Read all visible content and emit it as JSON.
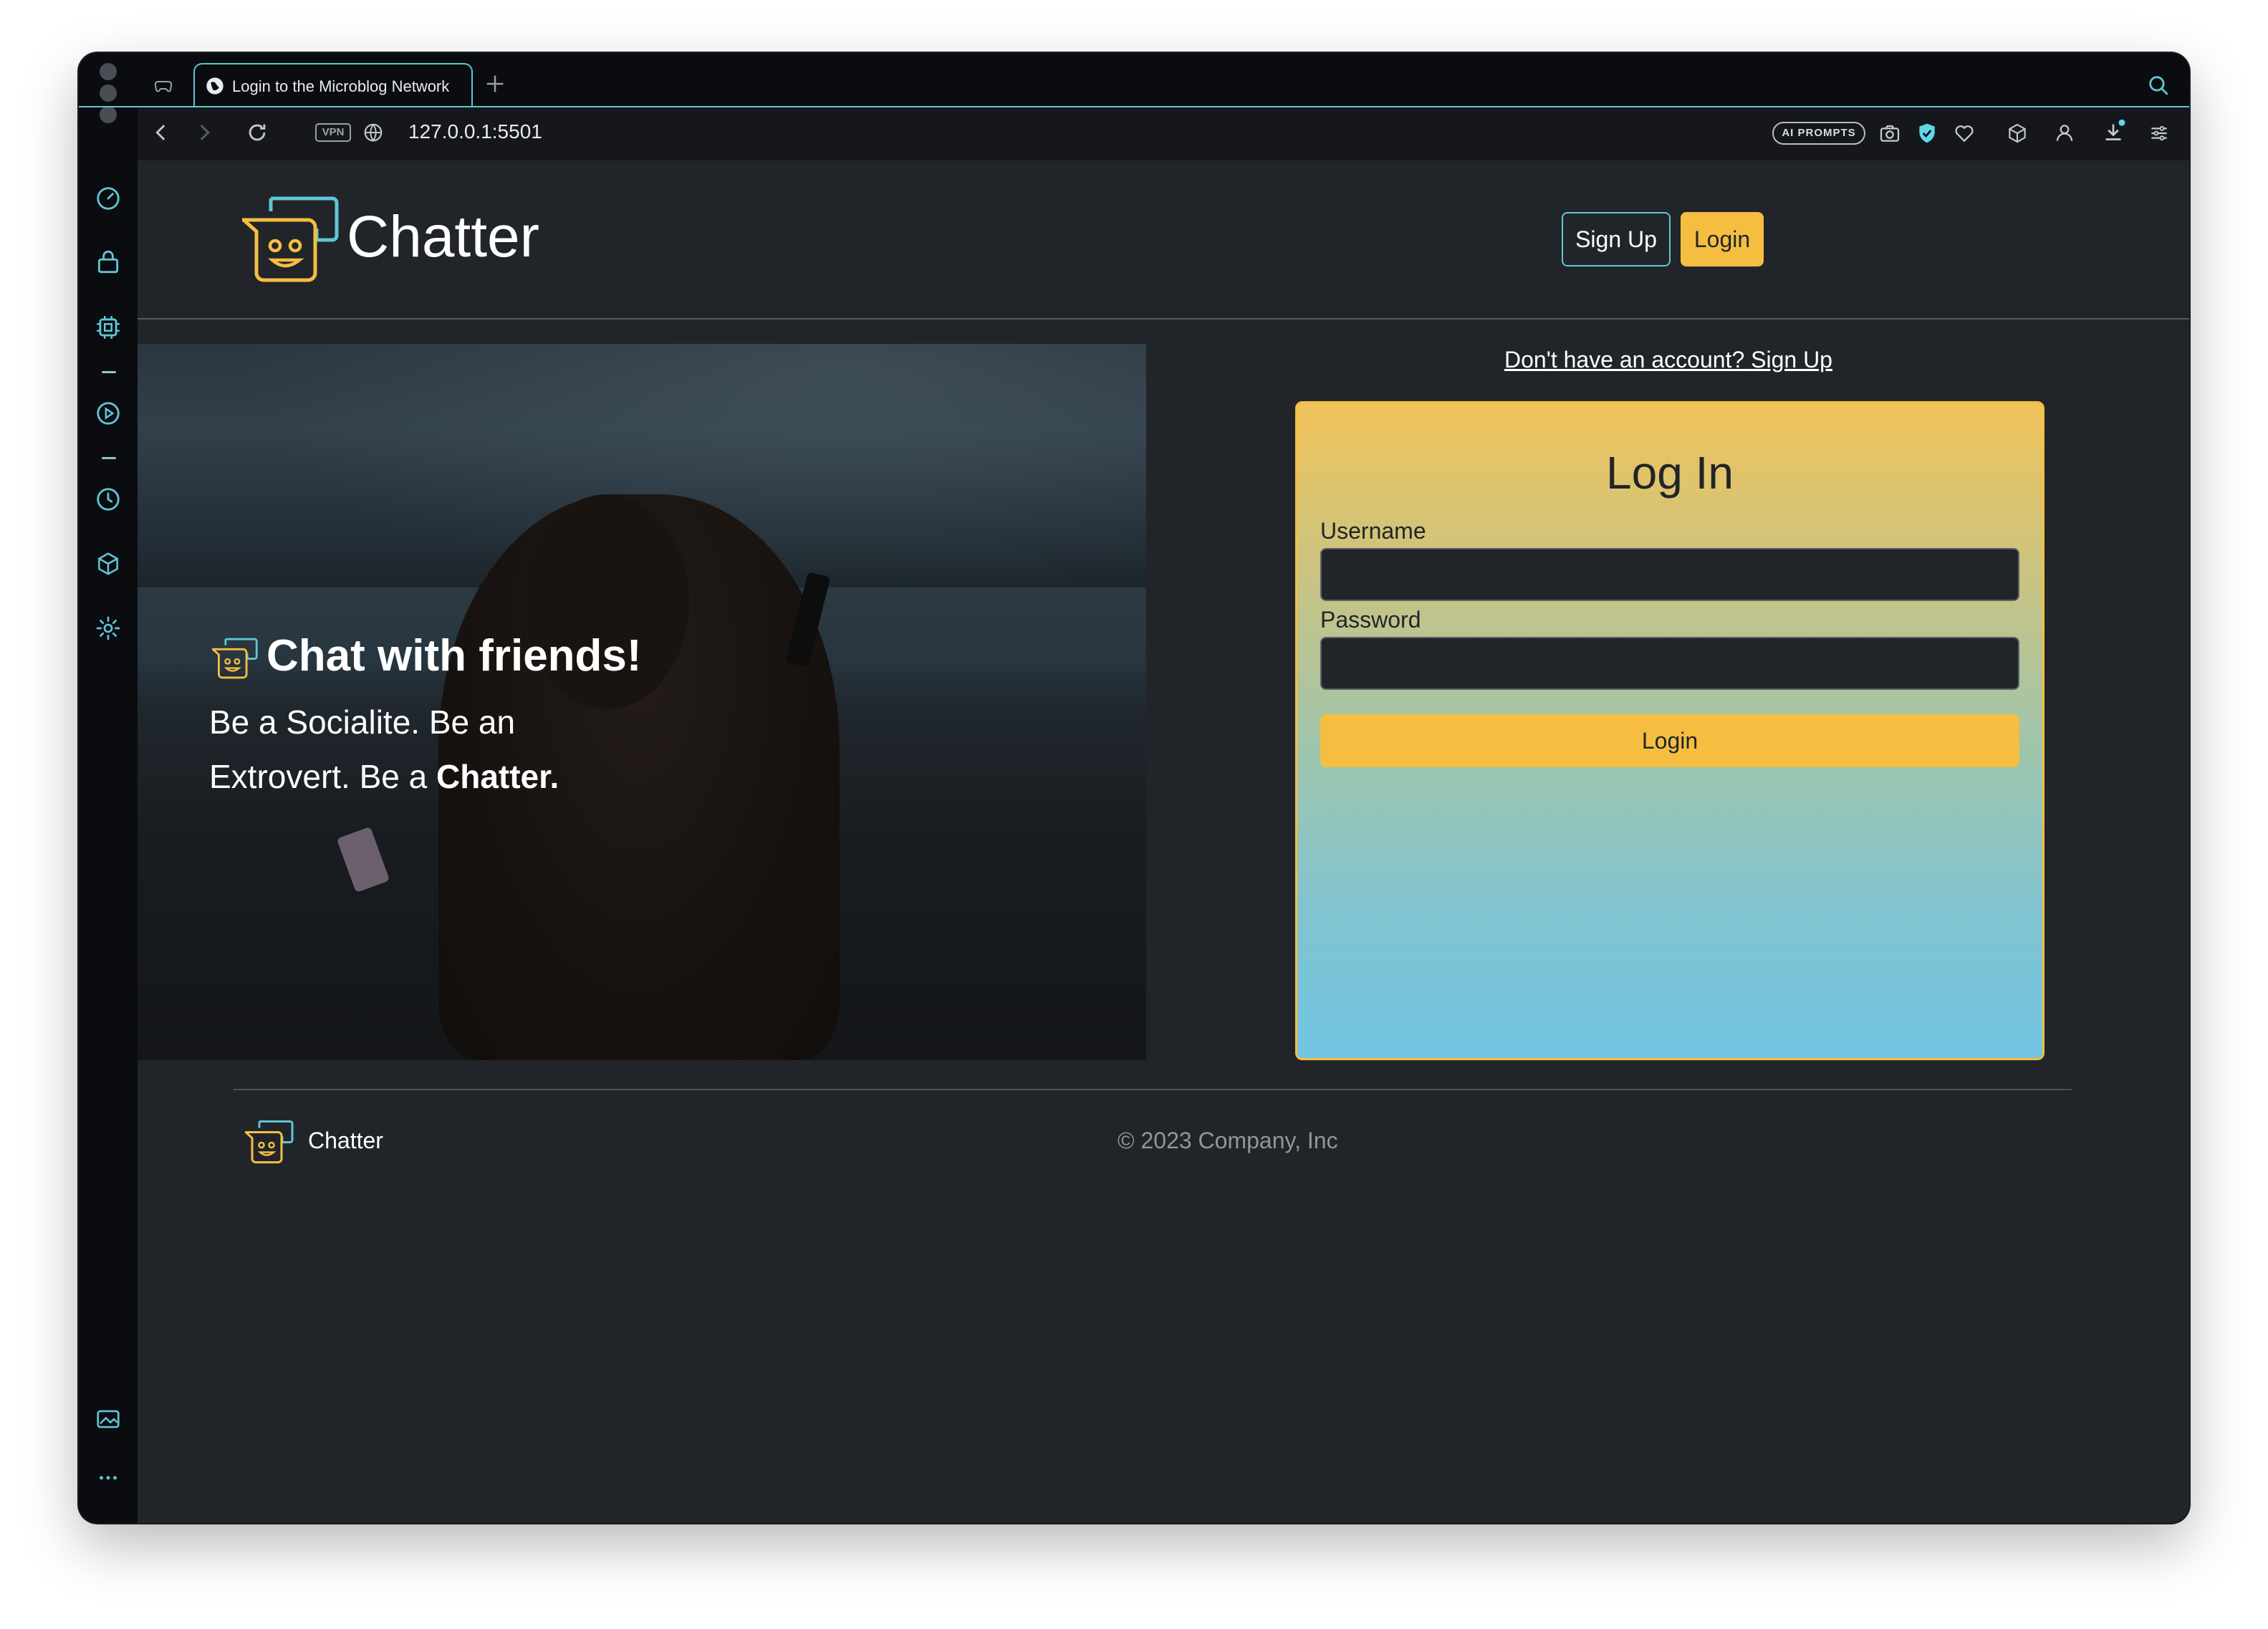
{
  "browser": {
    "tab_title": "Login to the Microblog Network",
    "url": "127.0.0.1:5501",
    "vpn_label": "VPN",
    "ai_prompts_label": "AI PROMPTS",
    "accent_color": "#5fc6d6"
  },
  "sidebar": {
    "icons": [
      "speedometer-icon",
      "shopping-bag-icon",
      "chip-icon",
      "play-circle-icon",
      "clock-icon",
      "cube-icon",
      "gear-icon",
      "image-gallery-icon",
      "more-icon"
    ]
  },
  "header": {
    "brand_name": "Chatter",
    "signup_label": "Sign Up",
    "login_label": "Login"
  },
  "hero": {
    "title": "Chat with friends!",
    "subtitle_line1": "Be a Socialite. Be an",
    "subtitle_line2_prefix": "Extrovert. Be a ",
    "subtitle_line2_bold": "Chatter."
  },
  "login": {
    "signup_link": "Don't have an account? Sign Up",
    "title": "Log In",
    "username_label": "Username",
    "username_value": "",
    "password_label": "Password",
    "password_value": "",
    "submit_label": "Login"
  },
  "footer": {
    "brand_name": "Chatter",
    "copyright": "© 2023 Company, Inc"
  },
  "colors": {
    "page_bg": "#212529",
    "brand_yellow": "#f5be41",
    "brand_cyan": "#5fc6d6"
  }
}
